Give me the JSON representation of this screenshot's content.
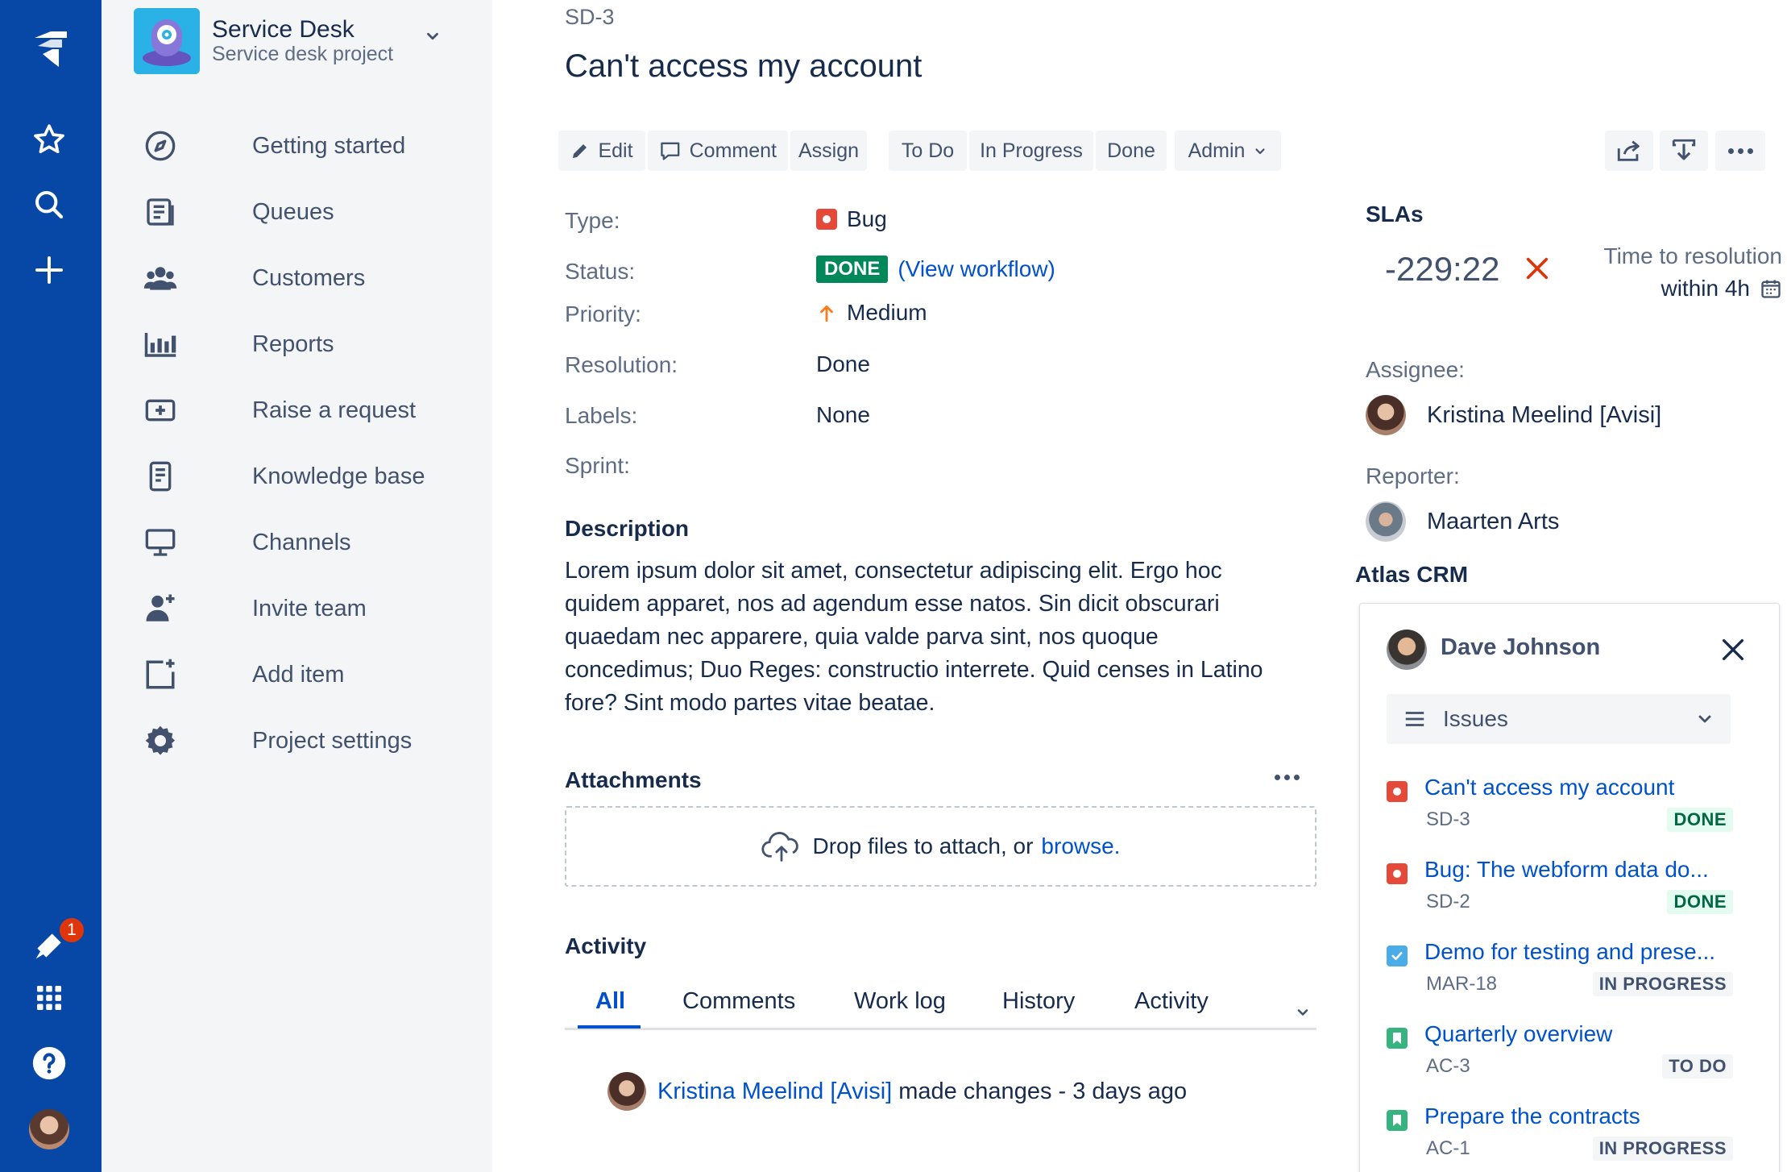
{
  "global_nav": {
    "notifications_count": "1"
  },
  "project": {
    "name": "Service Desk",
    "subtitle": "Service desk project",
    "nav": [
      {
        "label": "Getting started",
        "icon": "compass-icon"
      },
      {
        "label": "Queues",
        "icon": "queues-icon"
      },
      {
        "label": "Customers",
        "icon": "customers-icon"
      },
      {
        "label": "Reports",
        "icon": "reports-icon"
      },
      {
        "label": "Raise a request",
        "icon": "raise-request-icon"
      },
      {
        "label": "Knowledge base",
        "icon": "knowledge-base-icon"
      },
      {
        "label": "Channels",
        "icon": "channels-icon"
      },
      {
        "label": "Invite team",
        "icon": "invite-team-icon"
      },
      {
        "label": "Add item",
        "icon": "add-item-icon"
      },
      {
        "label": "Project settings",
        "icon": "gear-icon"
      }
    ]
  },
  "issue": {
    "key": "SD-3",
    "title": "Can't access my account"
  },
  "toolbar": {
    "edit": "Edit",
    "comment": "Comment",
    "assign": "Assign",
    "todo": "To Do",
    "in_progress": "In Progress",
    "done": "Done",
    "admin": "Admin"
  },
  "details": {
    "type_label": "Type:",
    "type_value": "Bug",
    "status_label": "Status:",
    "status_value": "DONE",
    "view_workflow": "(View workflow)",
    "priority_label": "Priority:",
    "priority_value": "Medium",
    "resolution_label": "Resolution:",
    "resolution_value": "Done",
    "labels_label": "Labels:",
    "labels_value": "None",
    "sprint_label": "Sprint:"
  },
  "description": {
    "heading": "Description",
    "text": "Lorem ipsum dolor sit amet, consectetur adipiscing elit. Ergo hoc quidem apparet, nos ad agendum esse natos. Sin dicit obscurari quaedam nec apparere, quia valde parva sint, nos quoque concedimus; Duo Reges: constructio interrete. Quid censes in Latino fore? Sint modo partes vitae beatae."
  },
  "attachments": {
    "heading": "Attachments",
    "drop_text": "Drop files to attach, or",
    "browse": "browse."
  },
  "activity": {
    "heading": "Activity",
    "tabs": [
      "All",
      "Comments",
      "Work log",
      "History",
      "Activity"
    ],
    "entry_user": "Kristina Meelind [Avisi]",
    "entry_text": "made changes - 3 days ago"
  },
  "sla": {
    "heading": "SLAs",
    "time": "-229:22",
    "label": "Time to resolution",
    "within": "within 4h"
  },
  "people": {
    "assignee_label": "Assignee:",
    "assignee": "Kristina Meelind [Avisi]",
    "reporter_label": "Reporter:",
    "reporter": "Maarten Arts"
  },
  "crm": {
    "heading": "Atlas CRM",
    "contact": "Dave Johnson",
    "select": "Issues",
    "issues": [
      {
        "title": "Can't access my account",
        "key": "SD-3",
        "status": "DONE",
        "type": "bug"
      },
      {
        "title": "Bug: The webform data do...",
        "key": "SD-2",
        "status": "DONE",
        "type": "bug"
      },
      {
        "title": "Demo for testing and prese...",
        "key": "MAR-18",
        "status": "IN PROGRESS",
        "type": "task"
      },
      {
        "title": "Quarterly overview",
        "key": "AC-3",
        "status": "TO DO",
        "type": "story"
      },
      {
        "title": "Prepare the contracts",
        "key": "AC-1",
        "status": "IN PROGRESS",
        "type": "story"
      }
    ]
  },
  "colors": {
    "global_nav": "#0747a6",
    "sidebar": "#f4f5f7",
    "link": "#0052cc",
    "done": "#00875a",
    "bug": "#e5493a",
    "story": "#36b37e",
    "task": "#4bade8"
  }
}
